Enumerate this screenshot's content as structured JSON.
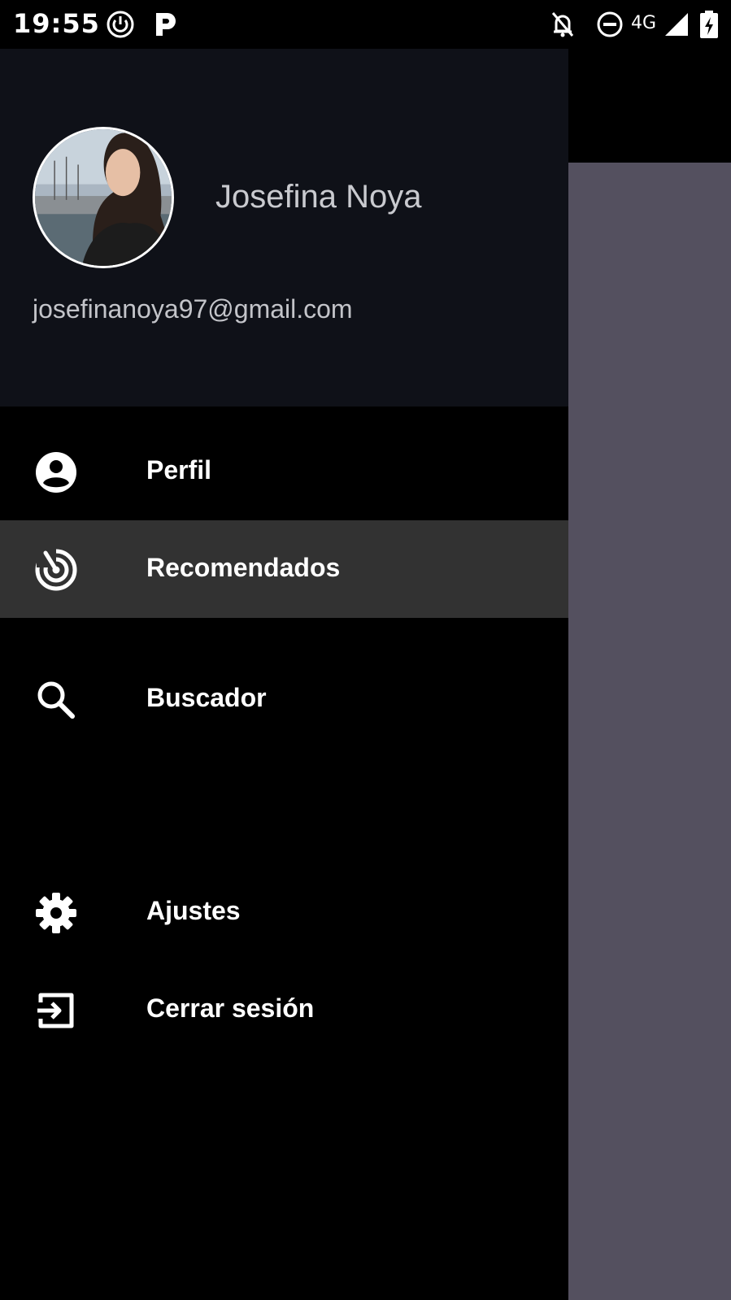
{
  "status_bar": {
    "time": "19:55",
    "left_icons": [
      "power-circle-icon",
      "parking-p-icon"
    ],
    "right_icons": [
      "notifications-off-icon",
      "do-not-disturb-icon",
      "signal-icon",
      "battery-charging-icon"
    ],
    "network": "4G"
  },
  "drawer": {
    "user": {
      "name": "Josefina Noya",
      "email": "josefinanoya97@gmail.com"
    },
    "items": [
      {
        "label": "Perfil",
        "icon": "account-circle-icon",
        "selected": false
      },
      {
        "label": "Recomendados",
        "icon": "radar-icon",
        "selected": true
      },
      {
        "label": "Buscador",
        "icon": "search-icon",
        "selected": false
      },
      {
        "label": "Ajustes",
        "icon": "gear-icon",
        "selected": false
      },
      {
        "label": "Cerrar sesión",
        "icon": "logout-icon",
        "selected": false
      }
    ]
  },
  "colors": {
    "header_bg": "#0f1118",
    "drawer_bg": "#000000",
    "selected_bg": "#323232",
    "scrim": "#54505f"
  }
}
